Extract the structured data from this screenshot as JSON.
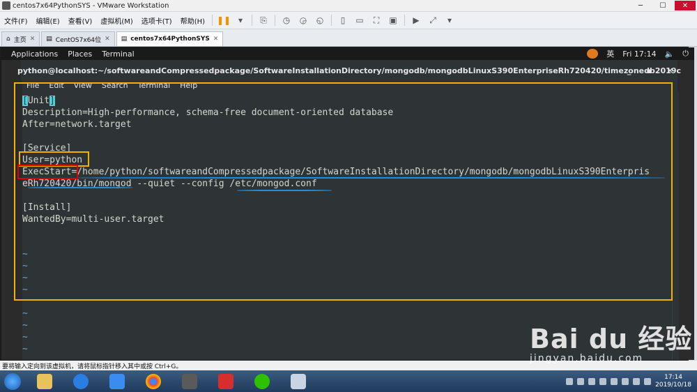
{
  "vmware": {
    "title": "centos7x64PythonSYS - VMware Workstation",
    "menu": [
      "文件(F)",
      "编辑(E)",
      "查看(V)",
      "虚拟机(M)",
      "选项卡(T)",
      "帮助(H)"
    ],
    "tabs": [
      {
        "label": "主页",
        "icon": "home-icon"
      },
      {
        "label": "CentOS7x64位",
        "icon": "vm-icon"
      },
      {
        "label": "centos7x64PythonSYS",
        "icon": "vm-icon",
        "active": true
      }
    ],
    "status_text": "要将输入定向到该虚拟机，请将鼠标指针移入其中或按 Ctrl+G。"
  },
  "gnome": {
    "applications": "Applications",
    "places": "Places",
    "terminal": "Terminal",
    "ime": "英",
    "clock": "Fri 17:14"
  },
  "terminal": {
    "title": "python@localhost:~/softwareandCompressedpackage/SoftwareInstallationDirectory/mongodb/mongodbLinuxS390EnterpriseRh720420/timezonedb2019c",
    "menu": [
      "File",
      "Edit",
      "View",
      "Search",
      "Terminal",
      "Help"
    ],
    "lines": [
      {
        "pre": "",
        "cur": "[",
        "mid": "Unit",
        "cur2": "]",
        "post": ""
      },
      "Description=High-performance, schema-free document-oriented database",
      "After=network.target",
      "",
      "[Service]",
      "User=python",
      "ExecStart=/home/python/softwareandCompressedpackage/SoftwareInstallationDirectory/mongodb/mongodbLinuxS390Enterpris",
      "eRh720420/bin/mongod --quiet --config /etc/mongod.conf",
      "",
      "[Install]",
      "WantedBy=multi-user.target"
    ],
    "tilde": "~"
  },
  "taskbar": {
    "time": "17:14",
    "date": "2019/10/18"
  },
  "watermark": {
    "brand": "Bai du 经验",
    "url": "jingyan.baidu.com"
  },
  "colors": {
    "highlight_yellow": "#f0b400",
    "highlight_red": "#e00000",
    "underline_blue": "#1d8fe0",
    "terminal_bg": "#2e3436"
  }
}
